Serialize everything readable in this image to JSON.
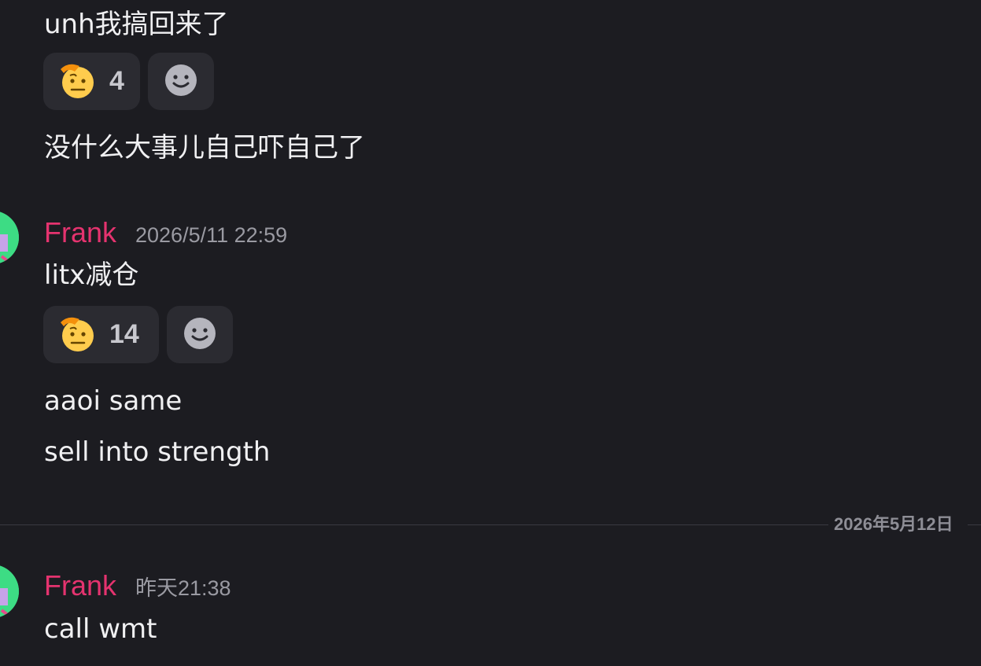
{
  "messages": {
    "m1": {
      "text": "unh我搞回来了"
    },
    "m1_reaction": {
      "emoji": "saluting-face",
      "count": "4"
    },
    "m2": {
      "text": "没什么大事儿自己吓自己了"
    },
    "group2": {
      "author": "Frank",
      "timestamp": "2026/5/11 22:59",
      "line1": "litx减仓",
      "reaction": {
        "emoji": "saluting-face",
        "count": "14"
      },
      "line2": "aaoi same",
      "line3": "sell into strength"
    },
    "date_divider": "2026年5月12日",
    "group3": {
      "author": "Frank",
      "timestamp": "昨天21:38",
      "line1": "call wmt"
    }
  },
  "colors": {
    "background": "#1c1c21",
    "author": "#e5336f",
    "reaction_bg": "#2b2b31",
    "avatar": "#3ddc84"
  },
  "icons": {
    "reaction_emoji": "saluting-face-icon",
    "add_reaction": "smiley-add-reaction-icon"
  }
}
